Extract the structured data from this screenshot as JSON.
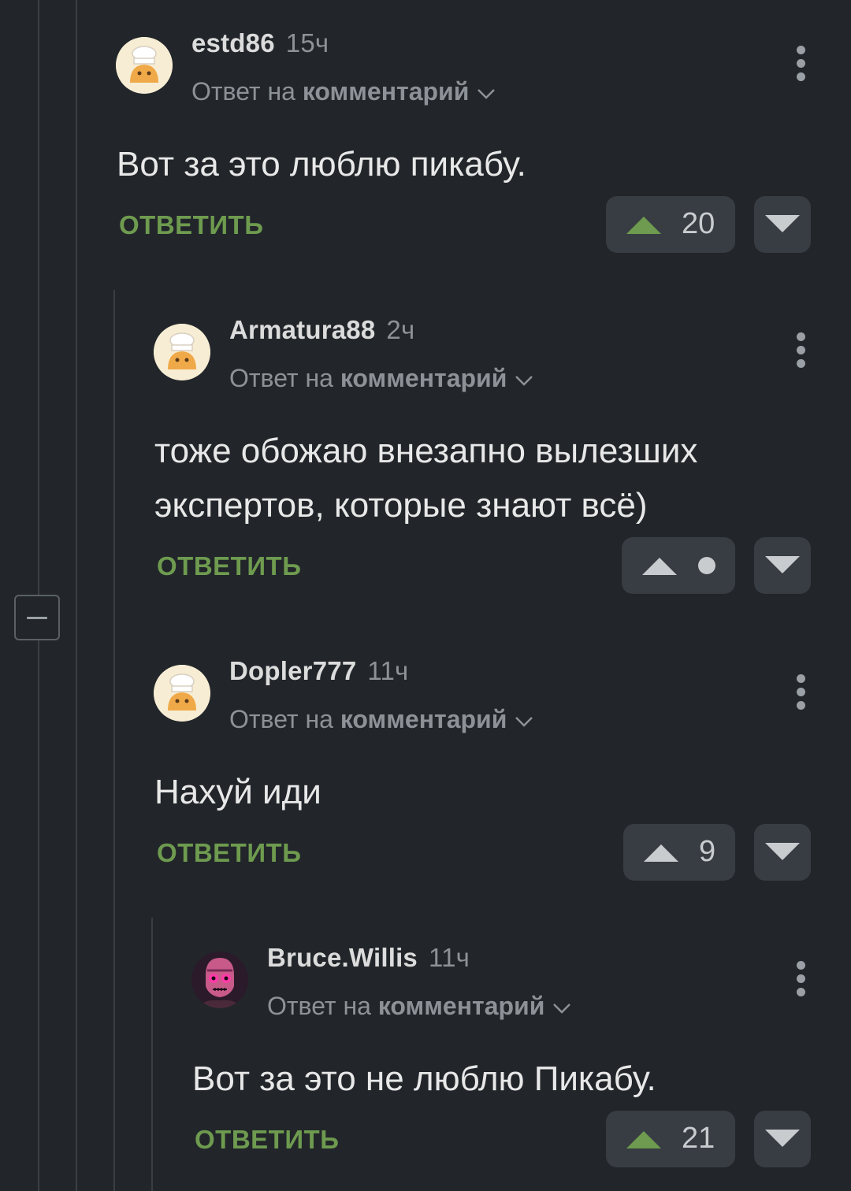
{
  "colors": {
    "background": "#22262a",
    "accent_green": "#6e9b4f",
    "vote_bg": "#383d43"
  },
  "comments": [
    {
      "username": "estd86",
      "time": "15ч",
      "reply_prefix": "Ответ на",
      "reply_target": "комментарий",
      "text_lines": [
        "Вот за это люблю пикабу."
      ],
      "reply_label": "ОТВЕТИТЬ",
      "rating": "20",
      "upvoted": true,
      "avatar": "cook-hat-avatar"
    },
    {
      "username": "Armatura88",
      "time": "2ч",
      "reply_prefix": "Ответ на",
      "reply_target": "комментарий",
      "text_lines": [
        "тоже обожаю внезапно вылезших",
        "экспертов, которые знают всё)"
      ],
      "reply_label": "ОТВЕТИТЬ",
      "rating": "",
      "upvoted": false,
      "avatar": "cook-hat-avatar"
    },
    {
      "username": "Dopler777",
      "time": "11ч",
      "reply_prefix": "Ответ на",
      "reply_target": "комментарий",
      "text_lines": [
        "Нахуй иди"
      ],
      "reply_label": "ОТВЕТИТЬ",
      "rating": "9",
      "upvoted": false,
      "avatar": "cook-hat-avatar"
    },
    {
      "username": "Bruce.Willis",
      "time": "11ч",
      "reply_prefix": "Ответ на",
      "reply_target": "комментарий",
      "text_lines": [
        "Вот за это не люблю Пикабу."
      ],
      "reply_label": "ОТВЕТИТЬ",
      "rating": "21",
      "upvoted": true,
      "avatar": "skull-avatar"
    }
  ]
}
